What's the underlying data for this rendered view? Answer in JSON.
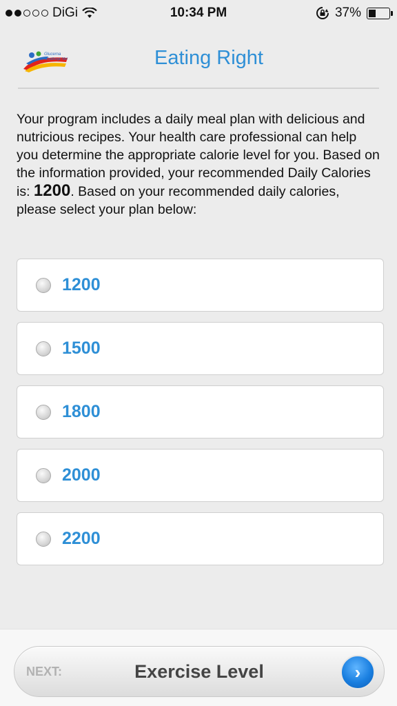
{
  "status": {
    "carrier": "DiGi",
    "time": "10:34 PM",
    "battery": "37%",
    "signal_bars_on": 2,
    "signal_bars_total": 5,
    "battery_level": 0.37
  },
  "header": {
    "title": "Eating Right",
    "logo_text": "Glucerna Challenge Me!"
  },
  "intro": {
    "text_before": "Your program includes a daily meal plan with delicious and nutricious recipes. Your health care professional can help you determine the appropriate calorie level for you. Based on the information provided, your recommended Daily Calories is: ",
    "calories": "1200",
    "text_after": ". Based on your recommended daily calories, please select your plan below:"
  },
  "options": [
    {
      "label": "1200"
    },
    {
      "label": "1500"
    },
    {
      "label": "1800"
    },
    {
      "label": "2000"
    },
    {
      "label": "2200"
    }
  ],
  "footer": {
    "next_label": "NEXT:",
    "next_text": "Exercise Level",
    "arrow_icon": "chevron-right-icon"
  },
  "colors": {
    "accent": "#2e8fd6",
    "button_blue": "#1a7fe0"
  }
}
